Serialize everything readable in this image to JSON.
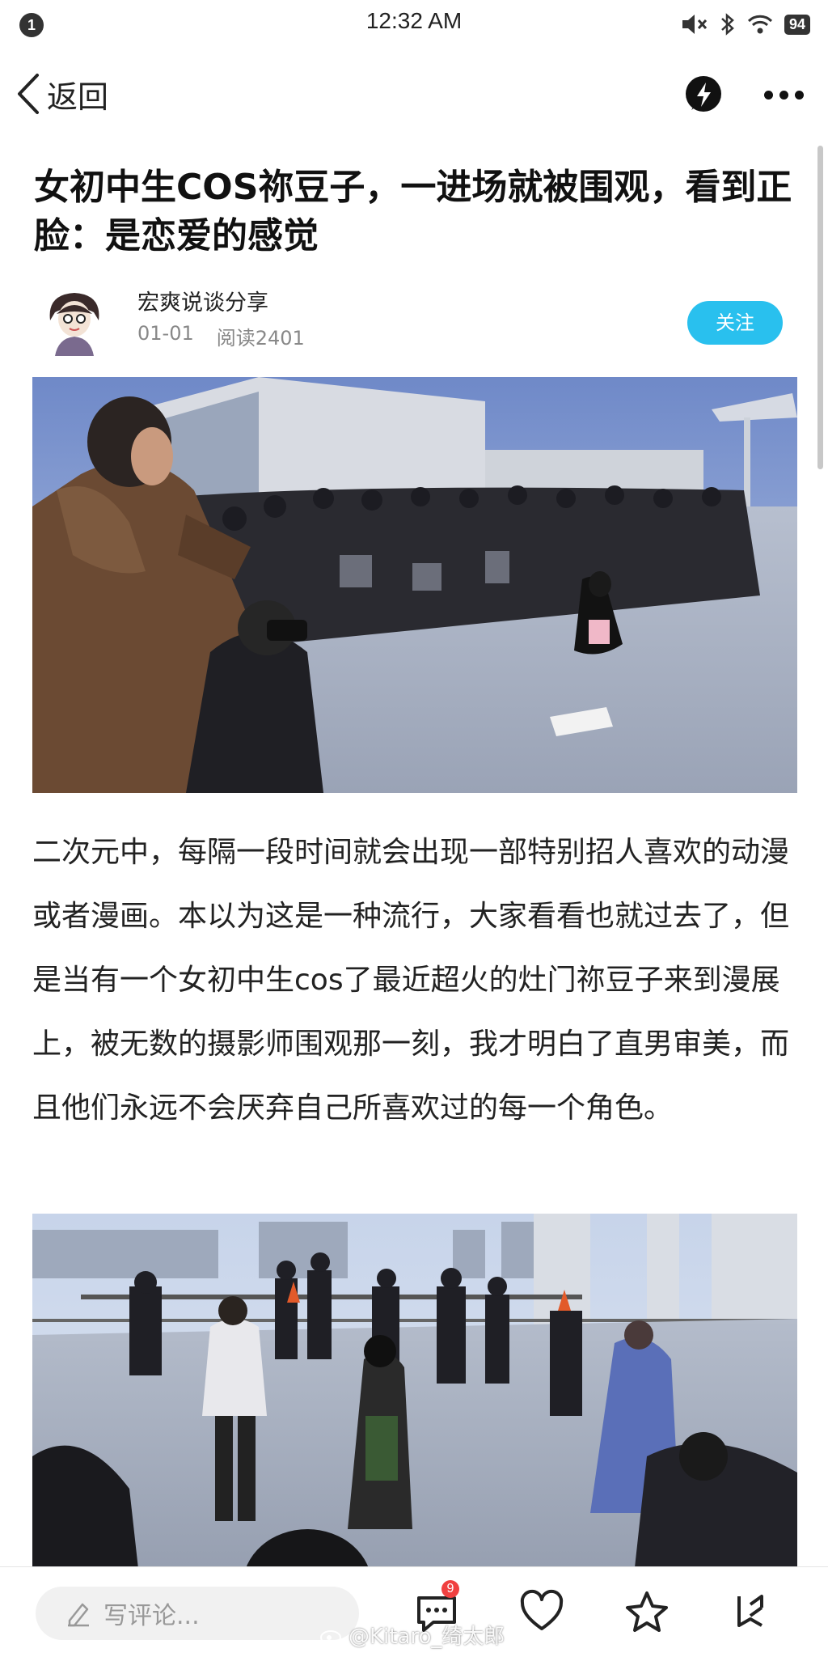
{
  "status_bar": {
    "notification_count": "1",
    "time": "12:32 AM",
    "battery": "94"
  },
  "nav": {
    "back_label": "返回"
  },
  "article": {
    "title": "女初中生COS祢豆子，一进场就被围观，看到正脸：是恋爱的感觉",
    "author_name": "宏爽说谈分享",
    "date": "01-01",
    "reads": "阅读2401",
    "follow_label": "关注",
    "body": "二次元中，每隔一段时间就会出现一部特别招人喜欢的动漫或者漫画。本以为这是一种流行，大家看看也就过去了，但是当有一个女初中生cos了最近超火的灶门祢豆子来到漫展上，被无数的摄影师围观那一刻，我才明白了直男审美，而且他们永远不会厌弃自己所喜欢过的每一个角色。"
  },
  "bottom_bar": {
    "comment_placeholder": "写评论...",
    "comment_count": "9",
    "watermark": "@Kitaro_绮太郎"
  },
  "colors": {
    "accent": "#29c0ee",
    "badge": "#f04040"
  }
}
